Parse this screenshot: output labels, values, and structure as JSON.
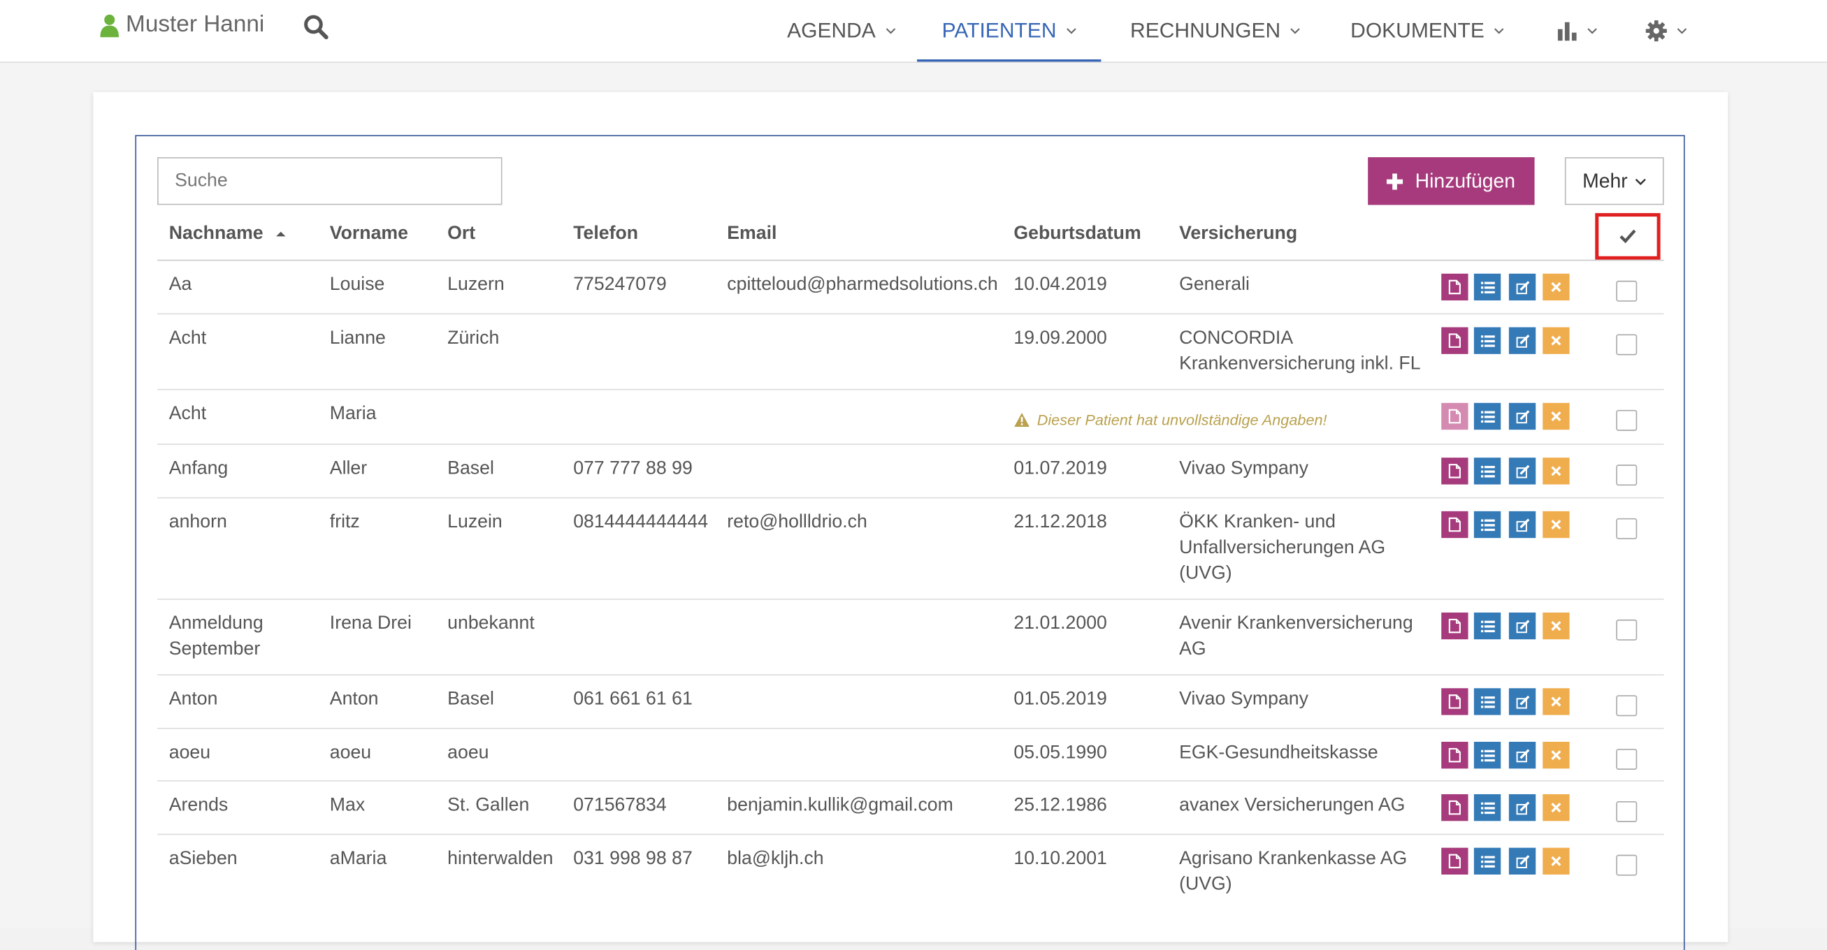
{
  "header": {
    "user_name": "Muster Hanni",
    "nav": [
      {
        "label": "AGENDA"
      },
      {
        "label": "PATIENTEN",
        "active": true
      },
      {
        "label": "RECHNUNGEN"
      },
      {
        "label": "DOKUMENTE"
      },
      {
        "label": "",
        "icon": "bar-chart-icon"
      },
      {
        "label": "",
        "icon": "gear-icon"
      }
    ]
  },
  "toolbar": {
    "search_placeholder": "Suche",
    "add_label": "Hinzufügen",
    "more_label": "Mehr"
  },
  "table": {
    "columns": [
      "Nachname",
      "Vorname",
      "Ort",
      "Telefon",
      "Email",
      "Geburtsdatum",
      "Versicherung"
    ],
    "sort_column": "Nachname",
    "sort_direction": "asc",
    "rows": [
      {
        "nachname": "Aa",
        "vorname": "Louise",
        "ort": "Luzern",
        "telefon": "775247079",
        "email": "cpitteloud@pharmedsolutions.ch",
        "geburtsdatum": "10.04.2019",
        "versicherung": "Generali",
        "warning": ""
      },
      {
        "nachname": "Acht",
        "vorname": "Lianne",
        "ort": "Zürich",
        "telefon": "",
        "email": "",
        "geburtsdatum": "19.09.2000",
        "versicherung": "CONCORDIA Krankenversicherung inkl. FL",
        "warning": ""
      },
      {
        "nachname": "Acht",
        "vorname": "Maria",
        "ort": "",
        "telefon": "",
        "email": "",
        "geburtsdatum": "",
        "versicherung": "",
        "warning": "Dieser Patient hat unvollständige Angaben!"
      },
      {
        "nachname": "Anfang",
        "vorname": "Aller",
        "ort": "Basel",
        "telefon": "077 777 88 99",
        "email": "",
        "geburtsdatum": "01.07.2019",
        "versicherung": "Vivao Sympany",
        "warning": ""
      },
      {
        "nachname": "anhorn",
        "vorname": "fritz",
        "ort": "Luzein",
        "telefon": "0814444444444",
        "email": "reto@hollldrio.ch",
        "geburtsdatum": "21.12.2018",
        "versicherung": "ÖKK Kranken- und Unfallversicherungen AG (UVG)",
        "warning": ""
      },
      {
        "nachname": "Anmeldung September",
        "vorname": "Irena Drei",
        "ort": "unbekannt",
        "telefon": "",
        "email": "",
        "geburtsdatum": "21.01.2000",
        "versicherung": "Avenir Krankenversicherung AG",
        "warning": ""
      },
      {
        "nachname": "Anton",
        "vorname": "Anton",
        "ort": "Basel",
        "telefon": "061 661 61 61",
        "email": "",
        "geburtsdatum": "01.05.2019",
        "versicherung": "Vivao Sympany",
        "warning": ""
      },
      {
        "nachname": "aoeu",
        "vorname": "aoeu",
        "ort": "aoeu",
        "telefon": "",
        "email": "",
        "geburtsdatum": "05.05.1990",
        "versicherung": "EGK-Gesundheitskasse",
        "warning": ""
      },
      {
        "nachname": "Arends",
        "vorname": "Max",
        "ort": "St. Gallen",
        "telefon": "071567834",
        "email": "benjamin.kullik@gmail.com",
        "geburtsdatum": "25.12.1986",
        "versicherung": "avanex Versicherungen AG",
        "warning": ""
      },
      {
        "nachname": "aSieben",
        "vorname": "aMaria",
        "ort": "hinterwalden",
        "telefon": "031 998 98 87",
        "email": "bla@kljh.ch",
        "geburtsdatum": "10.10.2001",
        "versicherung": "Agrisano Krankenkasse AG (UVG)",
        "warning": ""
      }
    ]
  },
  "colors": {
    "accent": "#3766b6",
    "add_button": "#a63a7c",
    "list_edit_button": "#337ab7",
    "delete_button": "#f0ad4e",
    "warning_text": "#b9a14d",
    "highlight_box": "#e02020",
    "user_icon": "#6cb33e"
  }
}
